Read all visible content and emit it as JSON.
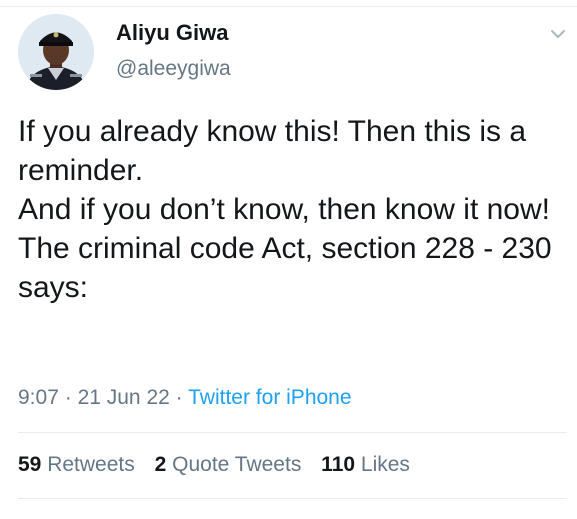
{
  "author": {
    "display_name": "Aliyu Giwa",
    "handle": "@aleeygiwa"
  },
  "tweet": {
    "lines": [
      "If you already know this! Then this is a reminder.",
      "And if you don’t know, then know it now!",
      "The criminal code Act, section 228 - 230 says:"
    ],
    "time": "9:07",
    "separator": "·",
    "date": "21 Jun 22",
    "source": "Twitter for iPhone"
  },
  "stats": {
    "retweets_count": "59",
    "retweets_label": "Retweets",
    "quotes_count": "2",
    "quotes_label": "Quote Tweets",
    "likes_count": "110",
    "likes_label": "Likes"
  },
  "icons": {
    "menu": "chevron-down-icon",
    "avatar": "avatar-photo"
  },
  "colors": {
    "text": "#14171a",
    "secondary": "#657786",
    "link": "#1da1f2",
    "divider": "#e6ecf0"
  }
}
